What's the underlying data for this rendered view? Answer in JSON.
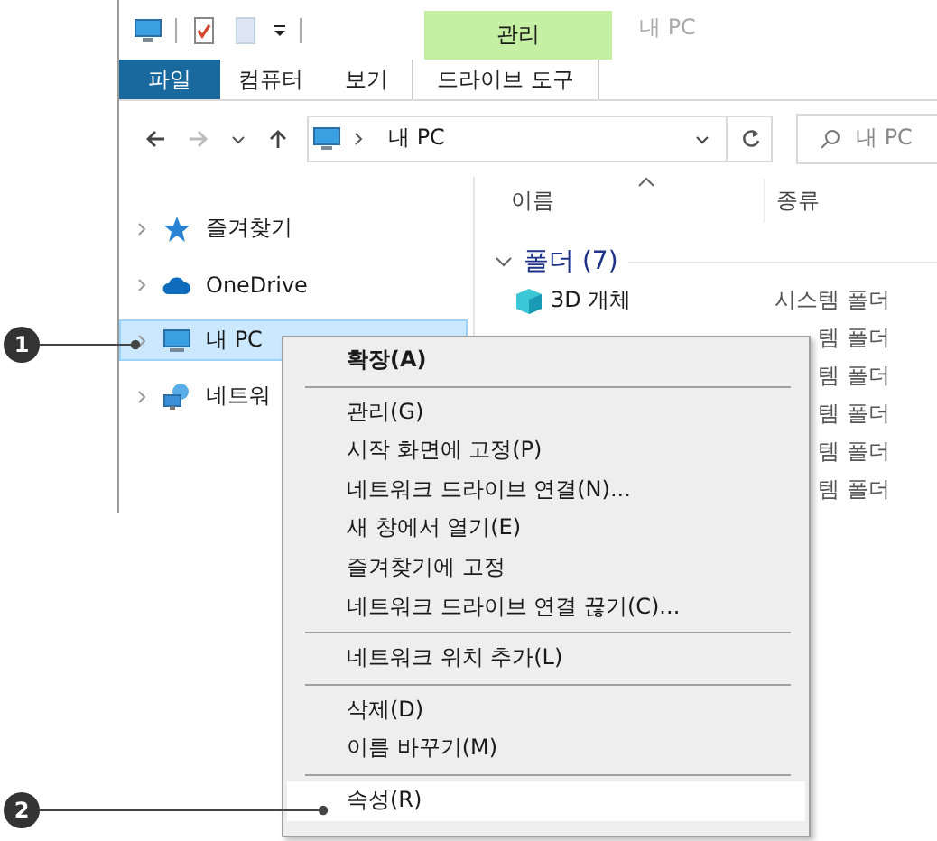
{
  "window": {
    "title": "내 PC"
  },
  "contextual_tab": {
    "group": "관리"
  },
  "ribbon_tabs": [
    {
      "label": "파일",
      "kind": "file",
      "selected": false
    },
    {
      "label": "컴퓨터",
      "kind": "normal",
      "selected": false
    },
    {
      "label": "보기",
      "kind": "normal",
      "selected": false
    },
    {
      "label": "드라이브 도구",
      "kind": "contextual",
      "selected": false
    }
  ],
  "address": {
    "path": "내 PC"
  },
  "search": {
    "placeholder": "내 PC"
  },
  "nav_items": [
    {
      "label": "즐겨찾기",
      "kind": "star",
      "selected": false
    },
    {
      "label": "OneDrive",
      "kind": "cloud",
      "selected": false
    },
    {
      "label": "내 PC",
      "kind": "pc",
      "selected": true
    },
    {
      "label": "네트워",
      "kind": "network",
      "selected": false
    }
  ],
  "columns": [
    "이름",
    "종류"
  ],
  "group": {
    "label": "폴더 (7)",
    "expanded": true
  },
  "files": [
    {
      "name": "3D 개체",
      "type": "시스템 폴더"
    },
    {
      "type": "템 폴더"
    },
    {
      "type": "템 폴더"
    },
    {
      "type": "템 폴더"
    },
    {
      "type": "템 폴더"
    },
    {
      "type": "템 폴더"
    }
  ],
  "context_menu": [
    {
      "kind": "item",
      "label": "확장(A)",
      "bold": true,
      "highlighted": false
    },
    {
      "kind": "separator"
    },
    {
      "kind": "item",
      "label": "관리(G)",
      "bold": false,
      "highlighted": false
    },
    {
      "kind": "item",
      "label": "시작 화면에 고정(P)",
      "bold": false,
      "highlighted": false
    },
    {
      "kind": "item",
      "label": "네트워크 드라이브 연결(N)...",
      "bold": false,
      "highlighted": false
    },
    {
      "kind": "item",
      "label": "새 창에서 열기(E)",
      "bold": false,
      "highlighted": false
    },
    {
      "kind": "item",
      "label": "즐겨찾기에 고정",
      "bold": false,
      "highlighted": false
    },
    {
      "kind": "item",
      "label": "네트워크 드라이브 연결 끊기(C)...",
      "bold": false,
      "highlighted": false
    },
    {
      "kind": "separator"
    },
    {
      "kind": "item",
      "label": "네트워크 위치 추가(L)",
      "bold": false,
      "highlighted": false
    },
    {
      "kind": "separator"
    },
    {
      "kind": "item",
      "label": "삭제(D)",
      "bold": false,
      "highlighted": false
    },
    {
      "kind": "item",
      "label": "이름 바꾸기(M)",
      "bold": false,
      "highlighted": false
    },
    {
      "kind": "separator"
    },
    {
      "kind": "item",
      "label": "속성(R)",
      "bold": false,
      "highlighted": true
    }
  ],
  "callouts": [
    "1",
    "2"
  ]
}
